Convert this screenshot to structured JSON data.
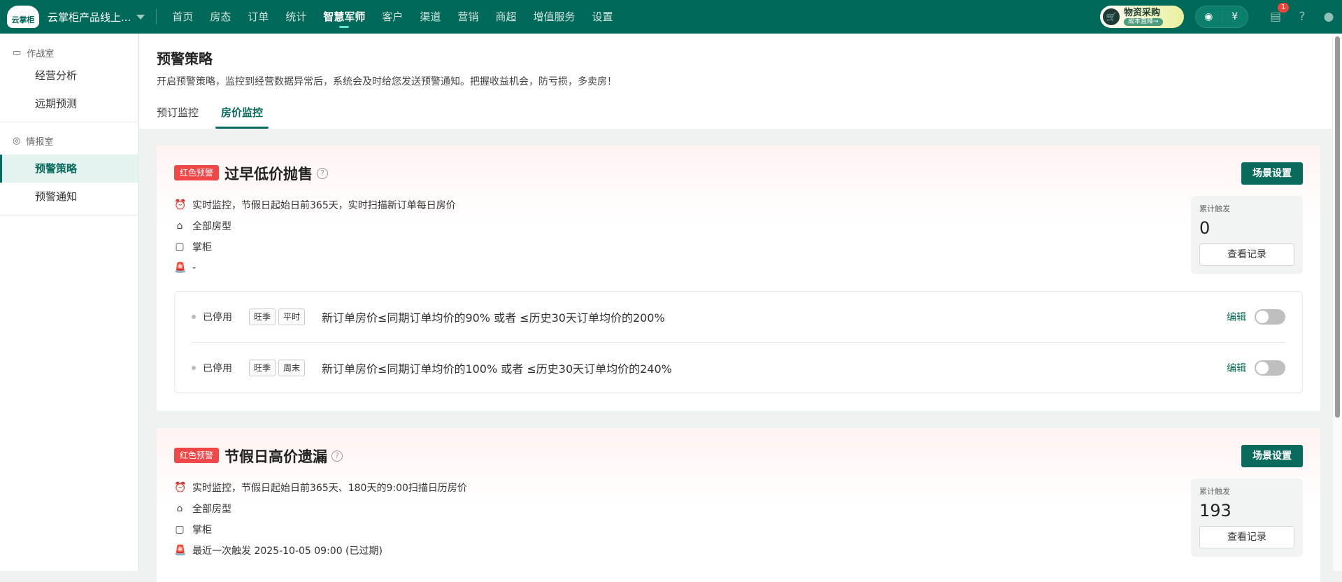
{
  "topbar": {
    "logo": "云掌柜",
    "shop": "云掌柜产品线上...",
    "nav": [
      "首页",
      "房态",
      "订单",
      "统计",
      "智慧军师",
      "客户",
      "渠道",
      "营销",
      "商超",
      "增值服务",
      "设置"
    ],
    "active_nav": 4,
    "promo": {
      "title": "物资采购",
      "subtitle": "成本直降→"
    },
    "notification_count": "1"
  },
  "sidebar": {
    "groups": [
      {
        "label": "作战室",
        "items": [
          "经营分析",
          "远期预测"
        ]
      },
      {
        "label": "情报室",
        "items": [
          "预警策略",
          "预警通知"
        ]
      }
    ],
    "active": "预警策略"
  },
  "header": {
    "title": "预警策略",
    "description": "开启预警策略，监控到经营数据异常后，系统会及时给您发送预警通知。把握收益机会，防亏损，多卖房！",
    "tabs": [
      "预订监控",
      "房价监控"
    ],
    "active_tab": 1
  },
  "cards": [
    {
      "badge": "红色预警",
      "title": "过早低价抛售",
      "monitor": "实时监控，节假日起始日前365天，实时扫描新订单每日房价",
      "rooms": "全部房型",
      "recipient": "掌柜",
      "last_trigger": "-",
      "scene_button": "场景设置",
      "stat_label": "累计触发",
      "stat_value": "0",
      "record_button": "查看记录",
      "rules": [
        {
          "status": "已停用",
          "tags": [
            "旺季",
            "平时"
          ],
          "text": "新订单房价≤同期订单均价的90% 或者 ≤历史30天订单均价的200%",
          "edit": "编辑",
          "enabled": false
        },
        {
          "status": "已停用",
          "tags": [
            "旺季",
            "周末"
          ],
          "text": "新订单房价≤同期订单均价的100% 或者 ≤历史30天订单均价的240%",
          "edit": "编辑",
          "enabled": false
        }
      ]
    },
    {
      "badge": "红色预警",
      "title": "节假日高价遗漏",
      "monitor": "实时监控，节假日起始日前365天、180天的9:00扫描日历房价",
      "rooms": "全部房型",
      "recipient": "掌柜",
      "last_trigger": "最近一次触发 2025-10-05 09:00 (已过期)",
      "scene_button": "场景设置",
      "stat_label": "累计触发",
      "stat_value": "193",
      "record_button": "查看记录"
    }
  ]
}
